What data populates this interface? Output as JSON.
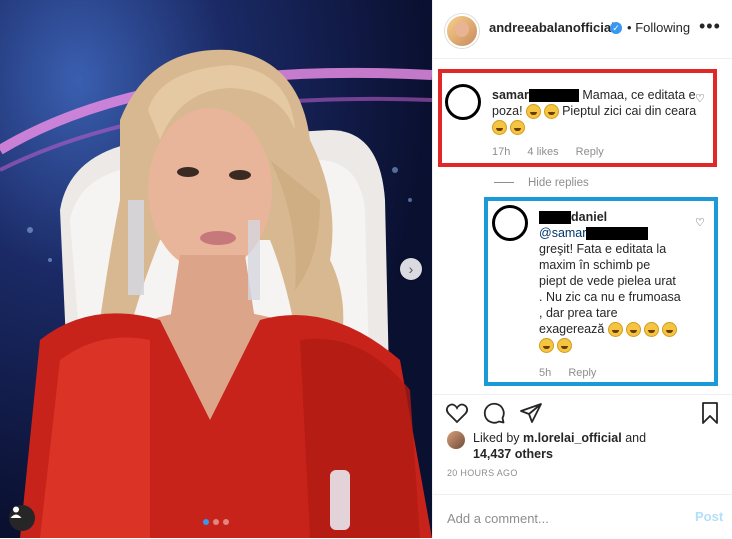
{
  "post": {
    "username": "andreeabalanofficial",
    "verified_icon": "verified-badge-icon",
    "separator": "•",
    "follow_status": "Following",
    "more_icon": "more-options-icon"
  },
  "comments": [
    {
      "user_visible": "samar",
      "text": "Mamaa, ce editata e poza!",
      "text2": "Pieptul zici cai din ceara",
      "time": "17h",
      "likes": "4 likes",
      "reply_label": "Reply"
    }
  ],
  "hide_replies_label": "Hide replies",
  "reply": {
    "user_visible": "daniel",
    "mention": "@samar",
    "lines": [
      "greşit! Fata e editata la",
      "maxim în schimb pe",
      "piept de vede pielea urat",
      ". Nu zic ca nu e frumoasa",
      ", dar prea tare",
      "exagerează"
    ],
    "time": "5h",
    "reply_label": "Reply"
  },
  "likes": {
    "prefix": "Liked by",
    "user": "m.lorelai_official",
    "and": "and",
    "others": "14,437 others"
  },
  "timestamp": "20 HOURS AGO",
  "add_comment": {
    "placeholder": "Add a comment...",
    "post_label": "Post"
  },
  "colors": {
    "red_box": "#e02828",
    "blue_box": "#1a9ad6",
    "link_blue": "#3897f0"
  }
}
